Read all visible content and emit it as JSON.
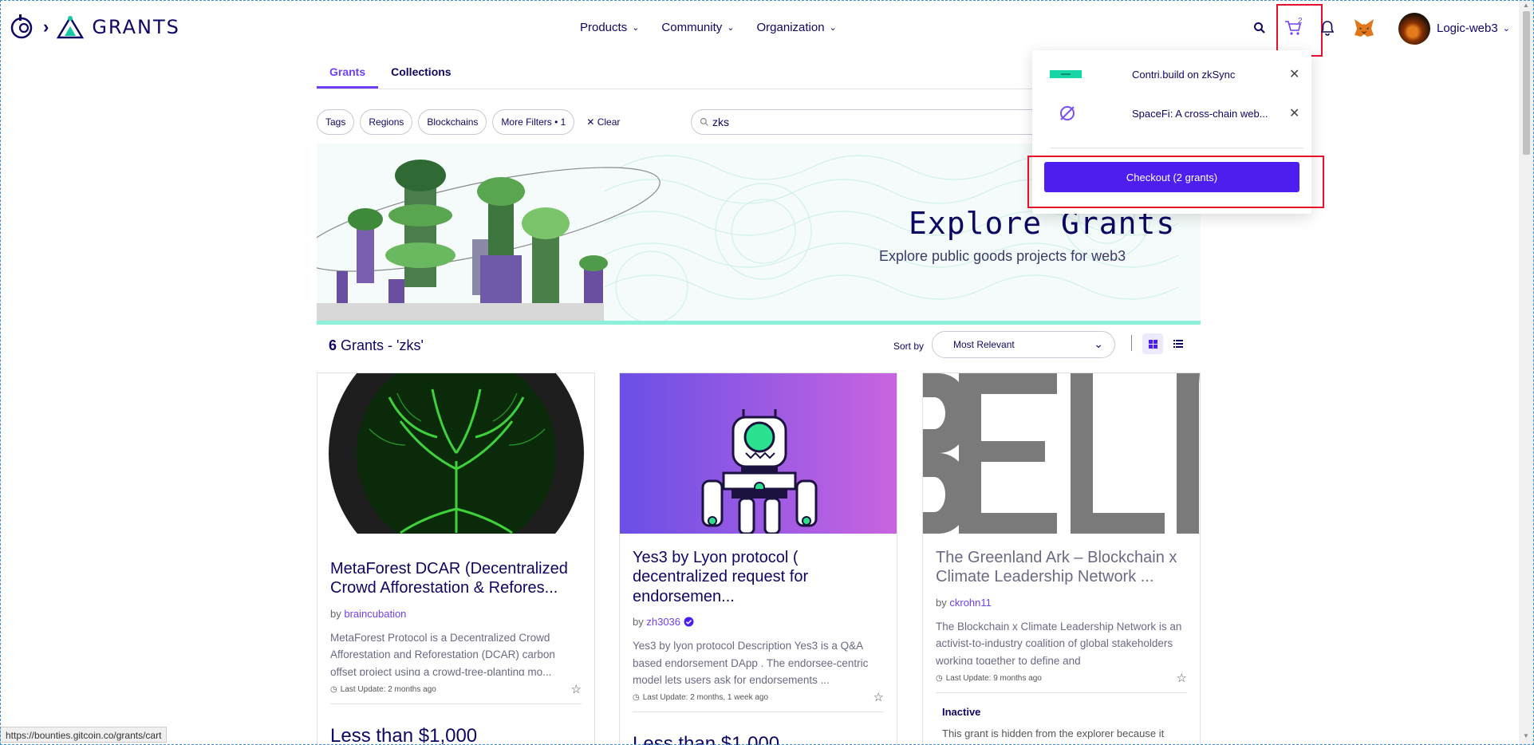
{
  "header": {
    "logo_text": "GRANTS",
    "nav": [
      {
        "label": "Products"
      },
      {
        "label": "Community"
      },
      {
        "label": "Organization"
      }
    ],
    "cart_count": "2",
    "user_name": "Logic-web3"
  },
  "tabs": [
    {
      "label": "Grants",
      "active": true
    },
    {
      "label": "Collections",
      "active": false
    }
  ],
  "filters": {
    "chips": [
      "Tags",
      "Regions",
      "Blockchains",
      "More Filters • 1"
    ],
    "clear_label": "Clear",
    "search_value": "zks"
  },
  "banner": {
    "title": "Explore Grants",
    "subtitle": "Explore public goods projects for web3"
  },
  "results": {
    "count": "6",
    "query_text": "Grants - 'zks'",
    "sort_label": "Sort by",
    "sort_value": "Most Relevant"
  },
  "cards": [
    {
      "title": "MetaForest DCAR (Decentralized Crowd Afforestation & Refores...",
      "by_prefix": "by",
      "author": "braincubation",
      "description": "MetaForest Protocol is a Decentralized Crowd Afforestation and Reforestation (DCAR) carbon offset project using a crowd-tree-planting mo...",
      "last_update": "Last Update: 2 months ago",
      "amount": "Less than $1,000"
    },
    {
      "title": "Yes3 by Lyon protocol ( decentralized request for endorsemen...",
      "by_prefix": "by",
      "author": "zh3036",
      "description": "Yes3 by lyon protocol Description Yes3 is a Q&A based endorsement DApp . The endorsee-centric model lets users ask for endorsements ...",
      "last_update": "Last Update: 2 months, 1 week ago",
      "amount": "Less than $1,000"
    },
    {
      "title": "The Greenland Ark – Blockchain x Climate Leadership Network ...",
      "by_prefix": "by",
      "author": "ckrohn11",
      "description": "The Blockchain x Climate Leadership Network is an activist-to-industry coalition of global stakeholders working together to define and",
      "last_update": "Last Update: 9 months ago",
      "inactive_label": "Inactive",
      "inactive_text": "This grant is hidden from the explorer because it"
    }
  ],
  "cart_dropdown": {
    "items": [
      {
        "name": "Contri.build on zkSync"
      },
      {
        "name": "SpaceFi: A cross-chain web..."
      }
    ],
    "checkout_label": "Checkout (2 grants)"
  },
  "status_bar_url": "https://bounties.gitcoin.co/grants/cart",
  "colors": {
    "accent": "#6f3ff5",
    "checkout": "#4e1ef1",
    "highlight_box": "#e8112d",
    "navy_text": "#0d0764"
  }
}
